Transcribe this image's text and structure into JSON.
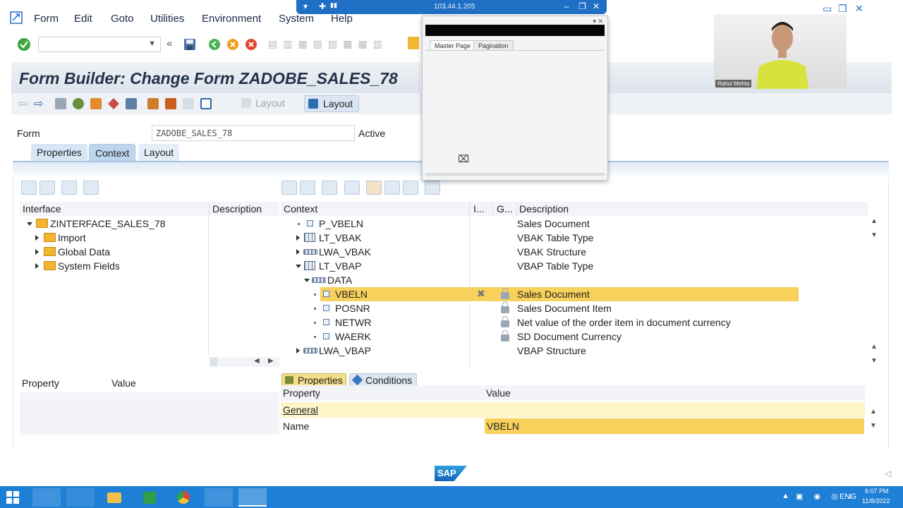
{
  "window": {
    "ip": "103.44.1.205"
  },
  "menu": [
    "Form",
    "Edit",
    "Goto",
    "Utilities",
    "Environment",
    "System",
    "Help"
  ],
  "header": {
    "title": "Form Builder: Change Form ZADOBE_SALES_78"
  },
  "app_toolbar": {
    "layout_disabled": "Layout",
    "layout_active": "Layout"
  },
  "form": {
    "label": "Form",
    "value": "ZADOBE_SALES_78",
    "status": "Active"
  },
  "tabs": [
    "Properties",
    "Context",
    "Layout"
  ],
  "interface_pane": {
    "col_interface": "Interface",
    "col_description": "Description",
    "items": [
      {
        "label": "ZINTERFACE_SALES_78"
      },
      {
        "label": "Import"
      },
      {
        "label": "Global Data"
      },
      {
        "label": "System Fields"
      }
    ]
  },
  "context_pane": {
    "col_context": "Context",
    "col_i": "I...",
    "col_g": "G...",
    "col_description": "Description",
    "rows": [
      {
        "name": "P_VBELN",
        "desc": "Sales Document"
      },
      {
        "name": "LT_VBAK",
        "desc": "VBAK Table Type"
      },
      {
        "name": "LWA_VBAK",
        "desc": "VBAK Structure"
      },
      {
        "name": "LT_VBAP",
        "desc": "VBAP Table Type"
      },
      {
        "name": "DATA",
        "desc": ""
      },
      {
        "name": "VBELN",
        "desc": "Sales Document"
      },
      {
        "name": "POSNR",
        "desc": "Sales Document Item"
      },
      {
        "name": "NETWR",
        "desc": "Net value of the order item in document currency"
      },
      {
        "name": "WAERK",
        "desc": "SD Document Currency"
      },
      {
        "name": "LWA_VBAP",
        "desc": "VBAP Structure"
      }
    ]
  },
  "left_props": {
    "col_property": "Property",
    "col_value": "Value"
  },
  "right_props": {
    "tab_properties": "Properties",
    "tab_conditions": "Conditions",
    "col_property": "Property",
    "col_value": "Value",
    "section": "General",
    "name_label": "Name",
    "name_value": "VBELN"
  },
  "dialog": {
    "tab_master": "Master Page",
    "tab_pagination": "Pagination"
  },
  "webcam": {
    "name": "Rahul Mehta"
  },
  "logo": "SAP",
  "taskbar": {
    "lang": "ENG",
    "time": "6:07 PM",
    "date": "11/8/2022"
  },
  "colors": {
    "highlight": "#f8d05c",
    "taskbar": "#1e7fd6",
    "accent": "#1f6fc5"
  }
}
